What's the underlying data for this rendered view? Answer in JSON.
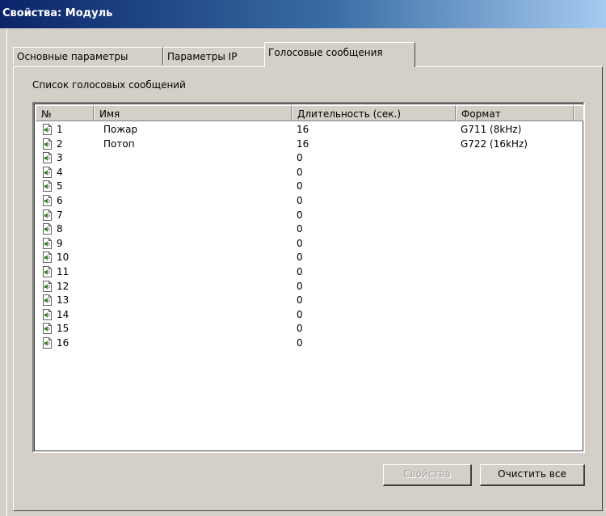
{
  "window": {
    "title": "Свойства: Модуль"
  },
  "tabs": [
    {
      "label": "Основные параметры"
    },
    {
      "label": "Параметры IP"
    },
    {
      "label": "Голосовые сообщения"
    }
  ],
  "group_label": "Список голосовых сообщений",
  "columns": [
    "№",
    "Имя",
    "Длительность (сек.)",
    "Формат"
  ],
  "rows": [
    {
      "num": "1",
      "name": "Пожар",
      "duration": "16",
      "format": "G711 (8kHz)"
    },
    {
      "num": "2",
      "name": "Потоп",
      "duration": "16",
      "format": "G722 (16kHz)"
    },
    {
      "num": "3",
      "name": "",
      "duration": "0",
      "format": ""
    },
    {
      "num": "4",
      "name": "",
      "duration": "0",
      "format": ""
    },
    {
      "num": "5",
      "name": "",
      "duration": "0",
      "format": ""
    },
    {
      "num": "6",
      "name": "",
      "duration": "0",
      "format": ""
    },
    {
      "num": "7",
      "name": "",
      "duration": "0",
      "format": ""
    },
    {
      "num": "8",
      "name": "",
      "duration": "0",
      "format": ""
    },
    {
      "num": "9",
      "name": "",
      "duration": "0",
      "format": ""
    },
    {
      "num": "10",
      "name": "",
      "duration": "0",
      "format": ""
    },
    {
      "num": "11",
      "name": "",
      "duration": "0",
      "format": ""
    },
    {
      "num": "12",
      "name": "",
      "duration": "0",
      "format": ""
    },
    {
      "num": "13",
      "name": "",
      "duration": "0",
      "format": ""
    },
    {
      "num": "14",
      "name": "",
      "duration": "0",
      "format": ""
    },
    {
      "num": "15",
      "name": "",
      "duration": "0",
      "format": ""
    },
    {
      "num": "16",
      "name": "",
      "duration": "0",
      "format": ""
    }
  ],
  "row_icon": "sound-file-icon",
  "buttons": {
    "properties": "Свойства",
    "clear_all": "Очистить все"
  },
  "colors": {
    "titlebar_start": "#0a246a",
    "titlebar_end": "#a6caf0",
    "face": "#d4d0c8"
  }
}
